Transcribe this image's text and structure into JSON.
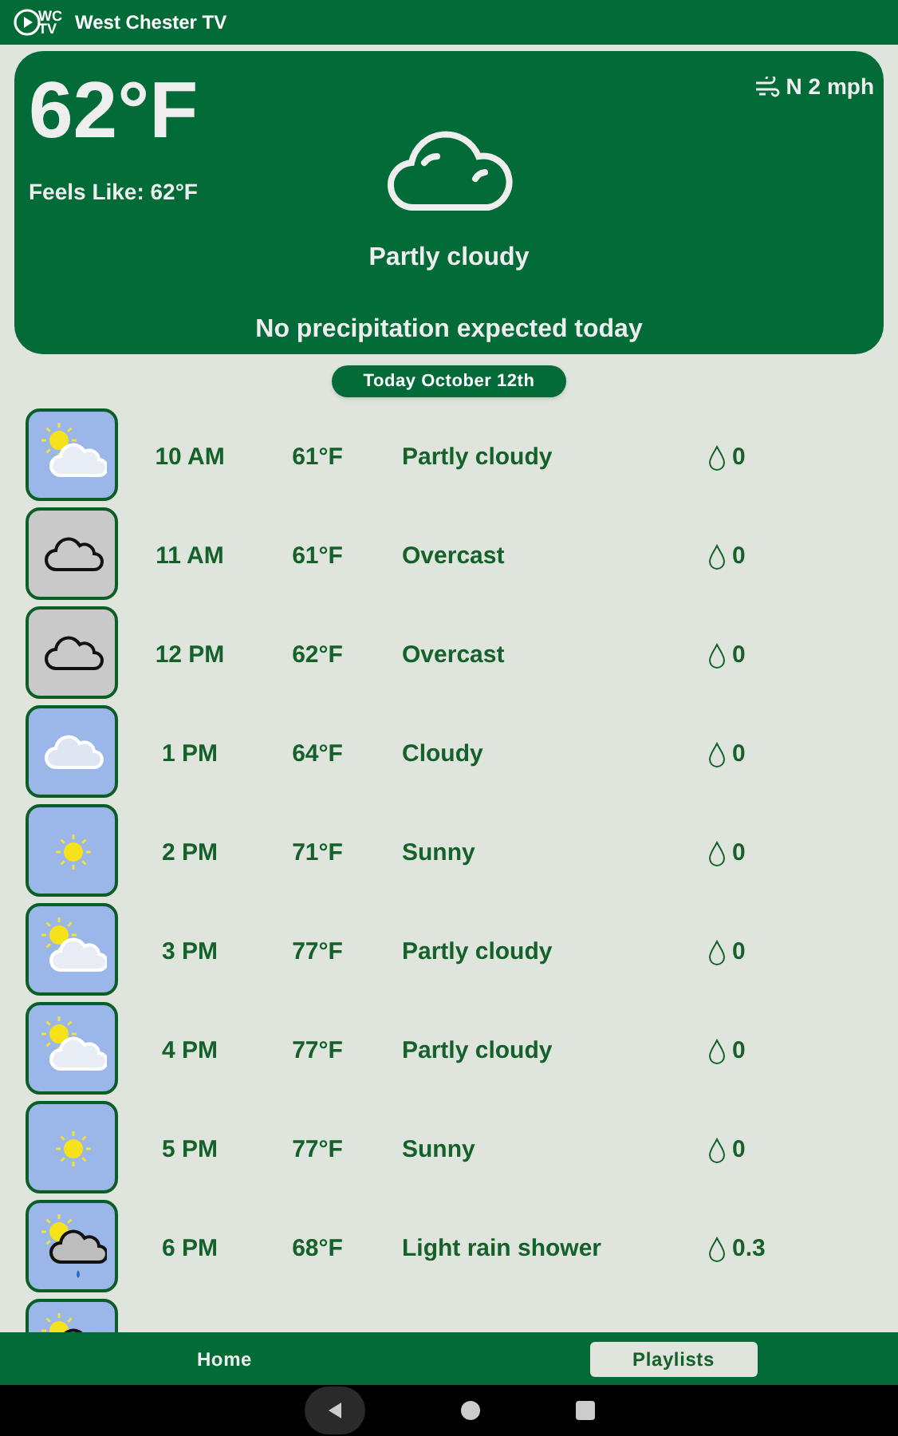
{
  "header": {
    "logo_text": "WC",
    "logo_text_2": "TV",
    "title": "West Chester TV"
  },
  "current": {
    "temperature": "62°F",
    "feels_like": "Feels Like: 62°F",
    "wind": "N 2 mph",
    "condition": "Partly cloudy",
    "precipitation": "No precipitation expected today"
  },
  "date_label": "Today October 12th",
  "hours": [
    {
      "kind": "partly",
      "time": "10 AM",
      "temp": "61°F",
      "condition": "Partly cloudy",
      "rain": "0"
    },
    {
      "kind": "overcast",
      "time": "11 AM",
      "temp": "61°F",
      "condition": "Overcast",
      "rain": "0"
    },
    {
      "kind": "overcast",
      "time": "12 PM",
      "temp": "62°F",
      "condition": "Overcast",
      "rain": "0"
    },
    {
      "kind": "cloudy",
      "time": "1 PM",
      "temp": "64°F",
      "condition": "Cloudy",
      "rain": "0"
    },
    {
      "kind": "sunny",
      "time": "2 PM",
      "temp": "71°F",
      "condition": "Sunny",
      "rain": "0"
    },
    {
      "kind": "partly",
      "time": "3 PM",
      "temp": "77°F",
      "condition": "Partly cloudy",
      "rain": "0"
    },
    {
      "kind": "partly",
      "time": "4 PM",
      "temp": "77°F",
      "condition": "Partly cloudy",
      "rain": "0"
    },
    {
      "kind": "sunny",
      "time": "5 PM",
      "temp": "77°F",
      "condition": "Sunny",
      "rain": "0"
    },
    {
      "kind": "rain",
      "time": "6 PM",
      "temp": "68°F",
      "condition": "Light rain shower",
      "rain": "0.3"
    },
    {
      "kind": "rain"
    }
  ],
  "tabs": [
    {
      "label": "Home",
      "selected": false
    },
    {
      "label": "Playlists",
      "selected": true
    }
  ]
}
